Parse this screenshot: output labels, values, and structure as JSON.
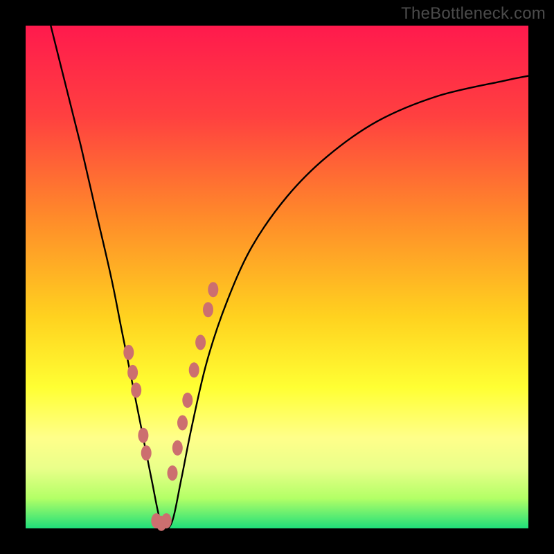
{
  "watermark": "TheBottleneck.com",
  "gradient": {
    "stops": [
      {
        "pct": 0,
        "color": "#ff1a4d"
      },
      {
        "pct": 18,
        "color": "#ff4040"
      },
      {
        "pct": 38,
        "color": "#ff8a2a"
      },
      {
        "pct": 58,
        "color": "#ffd21f"
      },
      {
        "pct": 72,
        "color": "#ffff33"
      },
      {
        "pct": 82,
        "color": "#ffff8a"
      },
      {
        "pct": 88,
        "color": "#eaff8a"
      },
      {
        "pct": 94,
        "color": "#b3ff66"
      },
      {
        "pct": 100,
        "color": "#1fdf7a"
      }
    ]
  },
  "colors": {
    "curve": "#000000",
    "marker_fill": "#cc6f6f",
    "marker_stroke": "#cc6f6f"
  },
  "chart_data": {
    "type": "line",
    "title": "",
    "xlabel": "",
    "ylabel": "",
    "xlim": [
      0,
      100
    ],
    "ylim": [
      0,
      100
    ],
    "sweet_spot_x": 27,
    "series": [
      {
        "name": "bottleneck-curve",
        "x": [
          5,
          8,
          11,
          14,
          17,
          19,
          21,
          23,
          25,
          27,
          29,
          31,
          33,
          36,
          40,
          45,
          52,
          60,
          70,
          82,
          95,
          100
        ],
        "y": [
          100,
          88,
          76,
          63,
          50,
          40,
          30,
          20,
          10,
          1,
          1,
          10,
          20,
          33,
          45,
          56,
          66,
          74,
          81,
          86,
          89,
          90
        ]
      }
    ],
    "markers": {
      "name": "highlight-points",
      "x": [
        20.5,
        21.3,
        22.0,
        23.4,
        24.0,
        26.0,
        27.0,
        28.0,
        29.2,
        30.2,
        31.2,
        32.2,
        33.5,
        34.8,
        36.3,
        37.3
      ],
      "y": [
        35.0,
        31.0,
        27.5,
        18.5,
        15.0,
        1.5,
        1.0,
        1.5,
        11.0,
        16.0,
        21.0,
        25.5,
        31.5,
        37.0,
        43.5,
        47.5
      ]
    }
  }
}
